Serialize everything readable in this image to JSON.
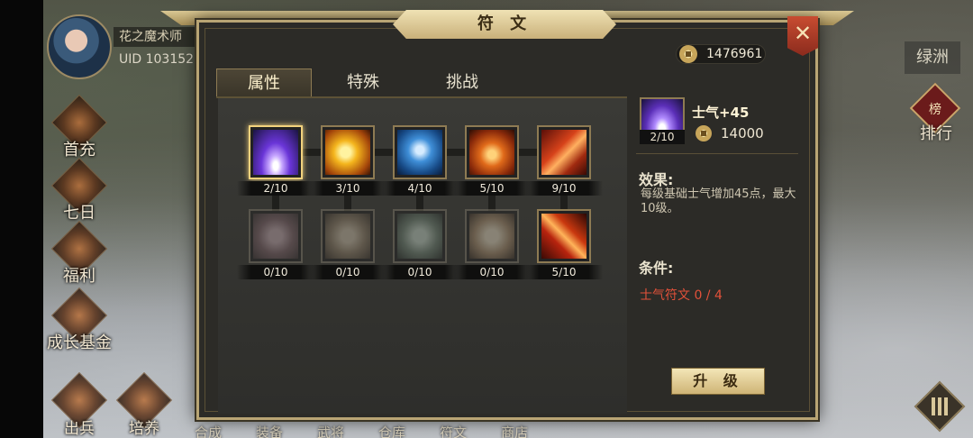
{
  "player": {
    "name": "花之魔术师",
    "uid": "UID  103152"
  },
  "left_menu": [
    "首充",
    "七日",
    "福利",
    "成长基金"
  ],
  "bottom_left_buttons": [
    "出兵",
    "培养"
  ],
  "bottom_strip": [
    "合成",
    "装备",
    "武将",
    "仓库",
    "符文",
    "商店"
  ],
  "right_hud": {
    "region": "绿洲",
    "rank_label": "排行",
    "rank_badge": "榜"
  },
  "dialog": {
    "title": "符 文",
    "close_glyph": "✕",
    "currency": "1476961",
    "tabs": [
      {
        "label": "属性",
        "active": true
      },
      {
        "label": "特殊",
        "active": false
      },
      {
        "label": "挑战",
        "active": false
      }
    ],
    "runes": [
      {
        "level": "2/10",
        "icon": "purple-light-icon",
        "selected": true,
        "locked": false
      },
      {
        "level": "3/10",
        "icon": "charging-warrior-icon",
        "selected": false,
        "locked": false
      },
      {
        "level": "4/10",
        "icon": "blue-shield-icon",
        "selected": false,
        "locked": false
      },
      {
        "level": "5/10",
        "icon": "fire-warrior-icon",
        "selected": false,
        "locked": false
      },
      {
        "level": "9/10",
        "icon": "flaming-blade-icon",
        "selected": false,
        "locked": false
      },
      {
        "level": "0/10",
        "icon": "pink-vortex-icon",
        "selected": false,
        "locked": true
      },
      {
        "level": "0/10",
        "icon": "running-warrior-icon",
        "selected": false,
        "locked": true
      },
      {
        "level": "0/10",
        "icon": "green-aura-icon",
        "selected": false,
        "locked": true
      },
      {
        "level": "0/10",
        "icon": "lightning-burst-icon",
        "selected": false,
        "locked": true
      },
      {
        "level": "5/10",
        "icon": "fire-sword-icon",
        "selected": false,
        "locked": false
      }
    ],
    "detail": {
      "name": "士气+45",
      "level": "2/10",
      "cost": "14000",
      "effect_title": "效果:",
      "effect_text": "每级基础士气增加45点，最大10级。",
      "condition_title": "条件:",
      "condition_text": "士气符文  0 / 4",
      "upgrade_label": "升 级"
    }
  },
  "colors": {
    "gold_border": "#b9a574",
    "selected_border": "#f2d27d",
    "condition_red": "#e2513a",
    "close_red": "#c84c31"
  }
}
